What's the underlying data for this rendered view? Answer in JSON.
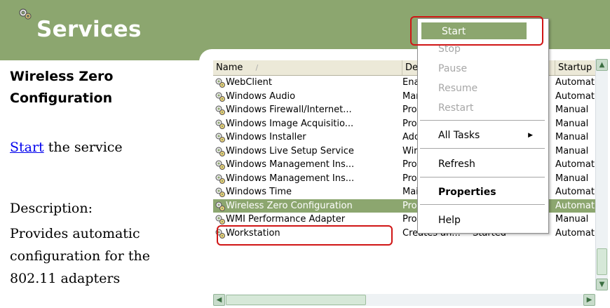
{
  "header": {
    "title": "Services",
    "icon": "gears-icon"
  },
  "left_pane": {
    "service_title": "Wireless Zero Configuration",
    "start_link": "Start",
    "start_suffix": " the service",
    "description_label": "Description:",
    "description_text": "Provides automatic configuration for the 802.11 adapters"
  },
  "list": {
    "columns": [
      "Name",
      "Des",
      "Startup"
    ],
    "rows": [
      {
        "name": "WebClient",
        "desc": "Ena",
        "status": "",
        "startup": "Automat"
      },
      {
        "name": "Windows Audio",
        "desc": "Mar",
        "status": "",
        "startup": "Automat"
      },
      {
        "name": "Windows Firewall/Internet...",
        "desc": "Pro",
        "status": "",
        "startup": "Manual"
      },
      {
        "name": "Windows Image Acquisitio...",
        "desc": "Pro",
        "status": "",
        "startup": "Manual"
      },
      {
        "name": "Windows Installer",
        "desc": "Adc",
        "status": "",
        "startup": "Manual"
      },
      {
        "name": "Windows Live Setup Service",
        "desc": "Wir",
        "status": "",
        "startup": "Manual"
      },
      {
        "name": "Windows Management Ins...",
        "desc": "Pro",
        "status": "",
        "startup": "Automat"
      },
      {
        "name": "Windows Management Ins...",
        "desc": "Pro",
        "status": "",
        "startup": "Manual"
      },
      {
        "name": "Windows Time",
        "desc": "Mai",
        "status": "",
        "startup": "Automat"
      },
      {
        "name": "Wireless Zero Configuration",
        "desc": "Provides a...",
        "status": "",
        "startup": "Automat",
        "selected": true
      },
      {
        "name": "WMI Performance Adapter",
        "desc": "Provides p...",
        "status": "",
        "startup": "Manual"
      },
      {
        "name": "Workstation",
        "desc": "Creates an...",
        "status": "Started",
        "startup": "Automat"
      }
    ]
  },
  "context_menu": {
    "items": [
      {
        "label": "Start",
        "enabled": true,
        "highlighted": true
      },
      {
        "label": "Stop",
        "enabled": false
      },
      {
        "label": "Pause",
        "enabled": false
      },
      {
        "label": "Resume",
        "enabled": false
      },
      {
        "label": "Restart",
        "enabled": false
      },
      {
        "label": "All Tasks",
        "enabled": true,
        "submenu": true
      },
      {
        "label": "Refresh",
        "enabled": true
      },
      {
        "label": "Properties",
        "enabled": true,
        "bold": true
      },
      {
        "label": "Help",
        "enabled": true
      }
    ]
  },
  "colors": {
    "accent": "#8ca66f",
    "highlight_box": "#d01515",
    "link": "#0000ee"
  }
}
